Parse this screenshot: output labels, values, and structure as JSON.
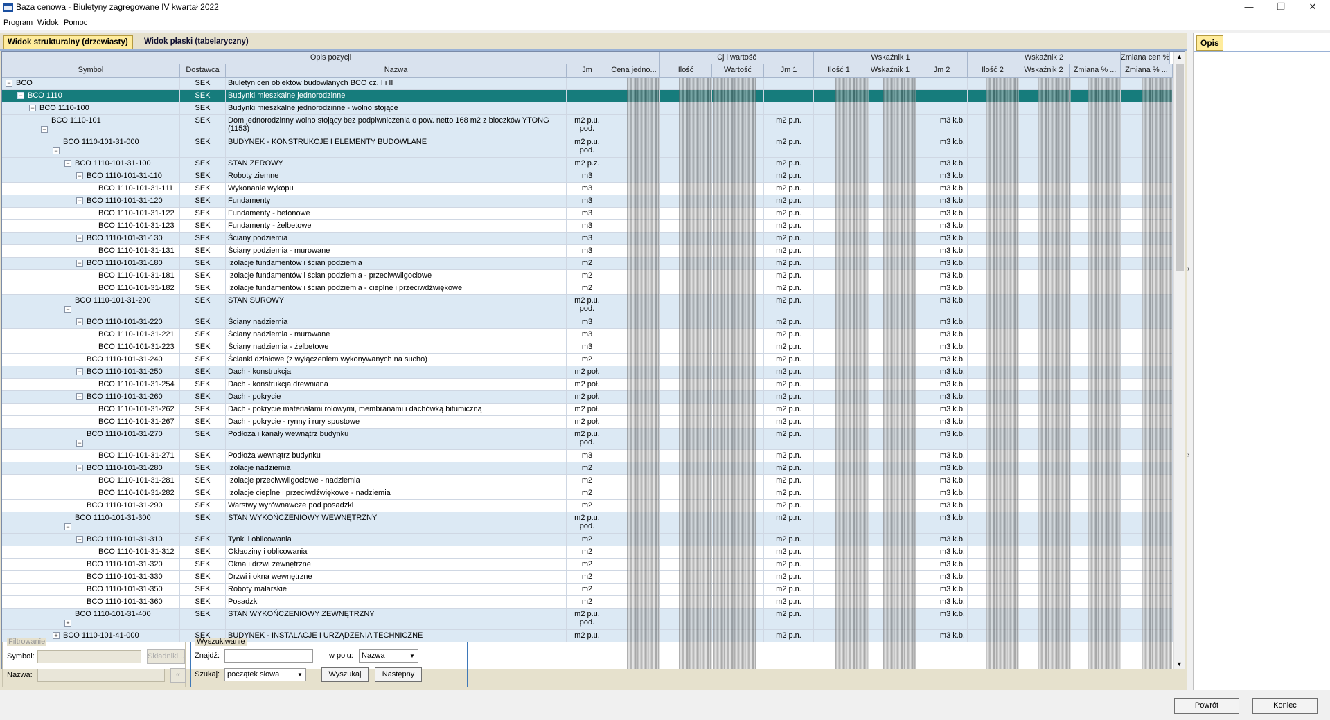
{
  "window": {
    "title": "Baza cenowa - Biuletyny zagregowane IV kwartał 2022",
    "minimize": "—",
    "maximize": "❐",
    "close": "✕"
  },
  "menu": [
    "Program",
    "Widok",
    "Pomoc"
  ],
  "tabs": [
    "Widok strukturalny (drzewiasty)",
    "Widok płaski (tabelaryczny)"
  ],
  "group_headers": [
    "Opis pozycji",
    "Cj i wartość",
    "Wskaźnik 1",
    "Wskaźnik 2",
    "Zmiana cen %"
  ],
  "columns": [
    "Symbol",
    "Dostawca",
    "Nazwa",
    "Jm",
    "Cena jedno...",
    "Ilość",
    "Wartość",
    "Jm 1",
    "Ilość 1",
    "Wskaźnik 1",
    "Jm 2",
    "Ilość 2",
    "Wskaźnik 2",
    "Zmiana % ...",
    "Zmiana % ..."
  ],
  "rows": [
    {
      "symbol": "BCO",
      "level": 0,
      "toggle": "−",
      "dostawca": "SEK",
      "nazwa": "Biuletyn cen obiektów budowlanych BCO cz. I i II",
      "jm": "",
      "jm1": "",
      "jm2": "",
      "kind": "c",
      "h": 18
    },
    {
      "symbol": "BCO 1110",
      "level": 1,
      "toggle": "−",
      "dostawca": "SEK",
      "nazwa": "Budynki mieszkalne jednorodzinne",
      "jm": "",
      "jm1": "",
      "jm2": "",
      "kind": "sel",
      "h": 18
    },
    {
      "symbol": "BCO 1110-100",
      "level": 2,
      "toggle": "−",
      "dostawca": "SEK",
      "nazwa": "Budynki mieszkalne jednorodzinne - wolno stojące",
      "jm": "",
      "jm1": "",
      "jm2": "",
      "kind": "c",
      "h": 18
    },
    {
      "symbol": "BCO 1110-101",
      "level": 3,
      "toggle": "−",
      "dostawca": "SEK",
      "nazwa": "Dom jednorodzinny wolno stojący bez podpiwniczenia o pow. netto 168 m2 z bloczków YTONG (1153)",
      "jm": "m2 p.u. pod.",
      "jm1": "m2 p.n.",
      "jm2": "m3 k.b.",
      "kind": "c",
      "h": 31
    },
    {
      "symbol": "BCO 1110-101-31-000",
      "level": 4,
      "toggle": "−",
      "dostawca": "SEK",
      "nazwa": "BUDYNEK - KONSTRUKCJE I ELEMENTY BUDOWLANE",
      "jm": "m2 p.u. pod.",
      "jm1": "m2 p.n.",
      "jm2": "m3 k.b.",
      "kind": "c",
      "h": 31
    },
    {
      "symbol": "BCO 1110-101-31-100",
      "level": 5,
      "toggle": "−",
      "dostawca": "SEK",
      "nazwa": "STAN ZEROWY",
      "jm": "m2 p.z.",
      "jm1": "m2 p.n.",
      "jm2": "m3 k.b.",
      "kind": "c",
      "h": 18
    },
    {
      "symbol": "BCO 1110-101-31-110",
      "level": 6,
      "toggle": "−",
      "dostawca": "SEK",
      "nazwa": "Roboty ziemne",
      "jm": "m3",
      "jm1": "m2 p.n.",
      "jm2": "m3 k.b.",
      "kind": "c",
      "h": 18
    },
    {
      "symbol": "BCO 1110-101-31-111",
      "level": 7,
      "toggle": "",
      "dostawca": "SEK",
      "nazwa": "Wykonanie wykopu",
      "jm": "m3",
      "jm1": "m2 p.n.",
      "jm2": "m3 k.b.",
      "kind": "l",
      "h": 18
    },
    {
      "symbol": "BCO 1110-101-31-120",
      "level": 6,
      "toggle": "−",
      "dostawca": "SEK",
      "nazwa": "Fundamenty",
      "jm": "m3",
      "jm1": "m2 p.n.",
      "jm2": "m3 k.b.",
      "kind": "c",
      "h": 18
    },
    {
      "symbol": "BCO 1110-101-31-122",
      "level": 7,
      "toggle": "",
      "dostawca": "SEK",
      "nazwa": "Fundamenty - betonowe",
      "jm": "m3",
      "jm1": "m2 p.n.",
      "jm2": "m3 k.b.",
      "kind": "l",
      "h": 18
    },
    {
      "symbol": "BCO 1110-101-31-123",
      "level": 7,
      "toggle": "",
      "dostawca": "SEK",
      "nazwa": "Fundamenty - żelbetowe",
      "jm": "m3",
      "jm1": "m2 p.n.",
      "jm2": "m3 k.b.",
      "kind": "l",
      "h": 18
    },
    {
      "symbol": "BCO 1110-101-31-130",
      "level": 6,
      "toggle": "−",
      "dostawca": "SEK",
      "nazwa": "Ściany podziemia",
      "jm": "m3",
      "jm1": "m2 p.n.",
      "jm2": "m3 k.b.",
      "kind": "c",
      "h": 18
    },
    {
      "symbol": "BCO 1110-101-31-131",
      "level": 7,
      "toggle": "",
      "dostawca": "SEK",
      "nazwa": "Ściany podziemia - murowane",
      "jm": "m3",
      "jm1": "m2 p.n.",
      "jm2": "m3 k.b.",
      "kind": "l",
      "h": 18
    },
    {
      "symbol": "BCO 1110-101-31-180",
      "level": 6,
      "toggle": "−",
      "dostawca": "SEK",
      "nazwa": "Izolacje fundamentów i ścian podziemia",
      "jm": "m2",
      "jm1": "m2 p.n.",
      "jm2": "m3 k.b.",
      "kind": "c",
      "h": 18
    },
    {
      "symbol": "BCO 1110-101-31-181",
      "level": 7,
      "toggle": "",
      "dostawca": "SEK",
      "nazwa": "Izolacje fundamentów i ścian podziemia - przeciwwilgociowe",
      "jm": "m2",
      "jm1": "m2 p.n.",
      "jm2": "m3 k.b.",
      "kind": "l",
      "h": 18
    },
    {
      "symbol": "BCO 1110-101-31-182",
      "level": 7,
      "toggle": "",
      "dostawca": "SEK",
      "nazwa": "Izolacje fundamentów i ścian podziemia - cieplne i przeciwdźwiękowe",
      "jm": "m2",
      "jm1": "m2 p.n.",
      "jm2": "m3 k.b.",
      "kind": "l",
      "h": 18
    },
    {
      "symbol": "BCO 1110-101-31-200",
      "level": 5,
      "toggle": "−",
      "dostawca": "SEK",
      "nazwa": "STAN SUROWY",
      "jm": "m2 p.u. pod.",
      "jm1": "m2 p.n.",
      "jm2": "m3 k.b.",
      "kind": "c",
      "h": 31
    },
    {
      "symbol": "BCO 1110-101-31-220",
      "level": 6,
      "toggle": "−",
      "dostawca": "SEK",
      "nazwa": "Ściany nadziemia",
      "jm": "m3",
      "jm1": "m2 p.n.",
      "jm2": "m3 k.b.",
      "kind": "c",
      "h": 18
    },
    {
      "symbol": "BCO 1110-101-31-221",
      "level": 7,
      "toggle": "",
      "dostawca": "SEK",
      "nazwa": "Ściany nadziemia - murowane",
      "jm": "m3",
      "jm1": "m2 p.n.",
      "jm2": "m3 k.b.",
      "kind": "l",
      "h": 18
    },
    {
      "symbol": "BCO 1110-101-31-223",
      "level": 7,
      "toggle": "",
      "dostawca": "SEK",
      "nazwa": "Ściany nadziemia - żelbetowe",
      "jm": "m3",
      "jm1": "m2 p.n.",
      "jm2": "m3 k.b.",
      "kind": "l",
      "h": 18
    },
    {
      "symbol": "BCO 1110-101-31-240",
      "level": 6,
      "toggle": "",
      "dostawca": "SEK",
      "nazwa": "Ścianki działowe (z wyłączeniem wykonywanych na sucho)",
      "jm": "m2",
      "jm1": "m2 p.n.",
      "jm2": "m3 k.b.",
      "kind": "l",
      "h": 18
    },
    {
      "symbol": "BCO 1110-101-31-250",
      "level": 6,
      "toggle": "−",
      "dostawca": "SEK",
      "nazwa": "Dach - konstrukcja",
      "jm": "m2 poł.",
      "jm1": "m2 p.n.",
      "jm2": "m3 k.b.",
      "kind": "c",
      "h": 18
    },
    {
      "symbol": "BCO 1110-101-31-254",
      "level": 7,
      "toggle": "",
      "dostawca": "SEK",
      "nazwa": "Dach - konstrukcja drewniana",
      "jm": "m2 poł.",
      "jm1": "m2 p.n.",
      "jm2": "m3 k.b.",
      "kind": "l",
      "h": 18
    },
    {
      "symbol": "BCO 1110-101-31-260",
      "level": 6,
      "toggle": "−",
      "dostawca": "SEK",
      "nazwa": "Dach - pokrycie",
      "jm": "m2 poł.",
      "jm1": "m2 p.n.",
      "jm2": "m3 k.b.",
      "kind": "c",
      "h": 18
    },
    {
      "symbol": "BCO 1110-101-31-262",
      "level": 7,
      "toggle": "",
      "dostawca": "SEK",
      "nazwa": "Dach - pokrycie materiałami rolowymi, membranami i dachówką bitumiczną",
      "jm": "m2 poł.",
      "jm1": "m2 p.n.",
      "jm2": "m3 k.b.",
      "kind": "l",
      "h": 18
    },
    {
      "symbol": "BCO 1110-101-31-267",
      "level": 7,
      "toggle": "",
      "dostawca": "SEK",
      "nazwa": "Dach - pokrycie - rynny i rury spustowe",
      "jm": "m2 poł.",
      "jm1": "m2 p.n.",
      "jm2": "m3 k.b.",
      "kind": "l",
      "h": 18
    },
    {
      "symbol": "BCO 1110-101-31-270",
      "level": 6,
      "toggle": "−",
      "dostawca": "SEK",
      "nazwa": "Podłoża i kanały wewnątrz budynku",
      "jm": "m2 p.u. pod.",
      "jm1": "m2 p.n.",
      "jm2": "m3 k.b.",
      "kind": "c",
      "h": 31
    },
    {
      "symbol": "BCO 1110-101-31-271",
      "level": 7,
      "toggle": "",
      "dostawca": "SEK",
      "nazwa": "Podłoża wewnątrz budynku",
      "jm": "m3",
      "jm1": "m2 p.n.",
      "jm2": "m3 k.b.",
      "kind": "l",
      "h": 18
    },
    {
      "symbol": "BCO 1110-101-31-280",
      "level": 6,
      "toggle": "−",
      "dostawca": "SEK",
      "nazwa": "Izolacje nadziemia",
      "jm": "m2",
      "jm1": "m2 p.n.",
      "jm2": "m3 k.b.",
      "kind": "c",
      "h": 18
    },
    {
      "symbol": "BCO 1110-101-31-281",
      "level": 7,
      "toggle": "",
      "dostawca": "SEK",
      "nazwa": "Izolacje przeciwwilgociowe - nadziemia",
      "jm": "m2",
      "jm1": "m2 p.n.",
      "jm2": "m3 k.b.",
      "kind": "l",
      "h": 18
    },
    {
      "symbol": "BCO 1110-101-31-282",
      "level": 7,
      "toggle": "",
      "dostawca": "SEK",
      "nazwa": "Izolacje cieplne i przeciwdźwiękowe - nadziemia",
      "jm": "m2",
      "jm1": "m2 p.n.",
      "jm2": "m3 k.b.",
      "kind": "l",
      "h": 18
    },
    {
      "symbol": "BCO 1110-101-31-290",
      "level": 6,
      "toggle": "",
      "dostawca": "SEK",
      "nazwa": "Warstwy wyrównawcze pod posadzki",
      "jm": "m2",
      "jm1": "m2 p.n.",
      "jm2": "m3 k.b.",
      "kind": "l",
      "h": 18
    },
    {
      "symbol": "BCO 1110-101-31-300",
      "level": 5,
      "toggle": "−",
      "dostawca": "SEK",
      "nazwa": "STAN WYKOŃCZENIOWY WEWNĘTRZNY",
      "jm": "m2 p.u. pod.",
      "jm1": "m2 p.n.",
      "jm2": "m3 k.b.",
      "kind": "c",
      "h": 31
    },
    {
      "symbol": "BCO 1110-101-31-310",
      "level": 6,
      "toggle": "−",
      "dostawca": "SEK",
      "nazwa": "Tynki i oblicowania",
      "jm": "m2",
      "jm1": "m2 p.n.",
      "jm2": "m3 k.b.",
      "kind": "c",
      "h": 18
    },
    {
      "symbol": "BCO 1110-101-31-312",
      "level": 7,
      "toggle": "",
      "dostawca": "SEK",
      "nazwa": "Okładziny i oblicowania",
      "jm": "m2",
      "jm1": "m2 p.n.",
      "jm2": "m3 k.b.",
      "kind": "l",
      "h": 18
    },
    {
      "symbol": "BCO 1110-101-31-320",
      "level": 6,
      "toggle": "",
      "dostawca": "SEK",
      "nazwa": "Okna i drzwi zewnętrzne",
      "jm": "m2",
      "jm1": "m2 p.n.",
      "jm2": "m3 k.b.",
      "kind": "l",
      "h": 18
    },
    {
      "symbol": "BCO 1110-101-31-330",
      "level": 6,
      "toggle": "",
      "dostawca": "SEK",
      "nazwa": "Drzwi i okna wewnętrzne",
      "jm": "m2",
      "jm1": "m2 p.n.",
      "jm2": "m3 k.b.",
      "kind": "l",
      "h": 18
    },
    {
      "symbol": "BCO 1110-101-31-350",
      "level": 6,
      "toggle": "",
      "dostawca": "SEK",
      "nazwa": "Roboty malarskie",
      "jm": "m2",
      "jm1": "m2 p.n.",
      "jm2": "m3 k.b.",
      "kind": "l",
      "h": 18
    },
    {
      "symbol": "BCO 1110-101-31-360",
      "level": 6,
      "toggle": "",
      "dostawca": "SEK",
      "nazwa": "Posadzki",
      "jm": "m2",
      "jm1": "m2 p.n.",
      "jm2": "m3 k.b.",
      "kind": "l",
      "h": 18
    },
    {
      "symbol": "BCO 1110-101-31-400",
      "level": 5,
      "toggle": "+",
      "dostawca": "SEK",
      "nazwa": "STAN WYKOŃCZENIOWY ZEWNĘTRZNY",
      "jm": "m2 p.u. pod.",
      "jm1": "m2 p.n.",
      "jm2": "m3 k.b.",
      "kind": "c",
      "h": 31
    },
    {
      "symbol": "BCO 1110-101-41-000",
      "level": 4,
      "toggle": "+",
      "dostawca": "SEK",
      "nazwa": "BUDYNEK - INSTALACJE I URZĄDZENIA TECHNICZNE",
      "jm": "m2 p.u.",
      "jm1": "m2 p.n.",
      "jm2": "m3 k.b.",
      "kind": "c",
      "h": 18
    }
  ],
  "filter": {
    "legend": "Filtrowanie",
    "symbol_label": "Symbol:",
    "nazwa_label": "Nazwa:",
    "skladniki": "Składniki..."
  },
  "search": {
    "legend": "Wyszukiwanie",
    "znajdz_label": "Znajdź:",
    "znajdz_value": "",
    "pole_label": "w polu:",
    "pole_value": "Nazwa",
    "szukaj_label": "Szukaj:",
    "szukaj_value": "początek słowa",
    "wyszukaj": "Wyszukaj",
    "nastepny": "Następny"
  },
  "side": {
    "tab": "Opis"
  },
  "footer": {
    "powrot": "Powrót",
    "koniec": "Koniec"
  }
}
